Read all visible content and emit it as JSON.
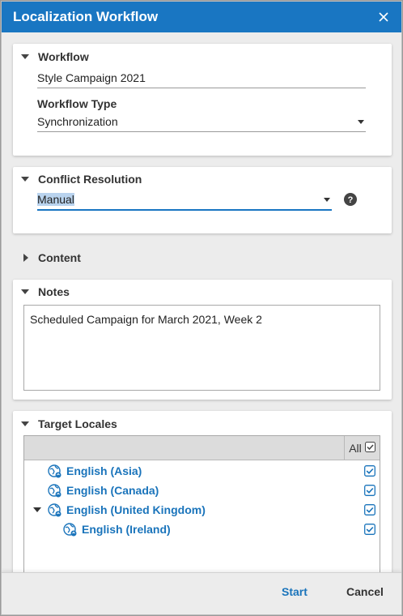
{
  "dialog": {
    "title": "Localization Workflow",
    "close_icon": "close-icon"
  },
  "workflow": {
    "header": "Workflow",
    "name_value": "Style Campaign 2021",
    "type_label": "Workflow Type",
    "type_value": "Synchronization"
  },
  "conflict": {
    "header": "Conflict Resolution",
    "value": "Manual",
    "help_icon": "help-icon"
  },
  "content": {
    "header": "Content"
  },
  "notes": {
    "header": "Notes",
    "text": "Scheduled Campaign for March 2021, Week 2"
  },
  "target_locales": {
    "header": "Target Locales",
    "all_label": "All",
    "all_checked": true,
    "items": [
      {
        "label": "English (Asia)",
        "checked": true,
        "level": 0,
        "expandable": false
      },
      {
        "label": "English (Canada)",
        "checked": true,
        "level": 0,
        "expandable": false
      },
      {
        "label": "English (United Kingdom)",
        "checked": true,
        "level": 0,
        "expandable": true,
        "expanded": true
      },
      {
        "label": "English (Ireland)",
        "checked": true,
        "level": 1,
        "expandable": false
      }
    ]
  },
  "footer": {
    "start_label": "Start",
    "cancel_label": "Cancel"
  },
  "colors": {
    "accent": "#1976c2",
    "link": "#1a74bb"
  }
}
